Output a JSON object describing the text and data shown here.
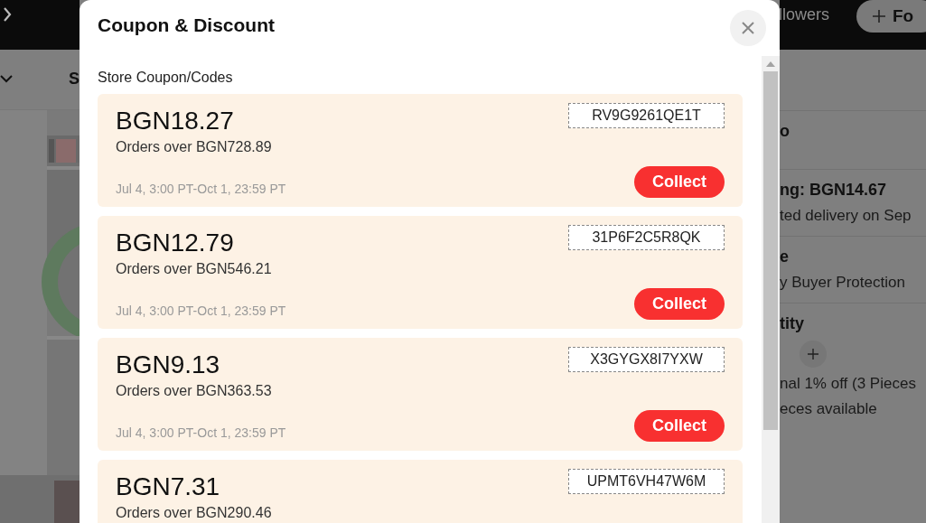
{
  "page": {
    "header": {
      "followers_label": "llowers",
      "follow_button": "Fo"
    },
    "nav": {
      "label": "S"
    },
    "sections": [
      {
        "title": "o"
      },
      {
        "title": "ng: BGN14.67",
        "lines": [
          "ted delivery on Sep"
        ]
      },
      {
        "title": "e",
        "lines": [
          "y Buyer Protection"
        ]
      },
      {
        "title": "tity",
        "kind": "quantity",
        "lines": [
          "nal 1% off (3 Pieces",
          "eces available"
        ]
      }
    ]
  },
  "modal": {
    "title": "Coupon & Discount",
    "section_title": "Store Coupon/Codes",
    "coupons": [
      {
        "amount": "BGN18.27",
        "condition": "Orders over BGN728.89",
        "validity": "Jul 4, 3:00 PT-Oct 1, 23:59 PT",
        "code": "RV9G9261QE1T",
        "button": "Collect"
      },
      {
        "amount": "BGN12.79",
        "condition": "Orders over BGN546.21",
        "validity": "Jul 4, 3:00 PT-Oct 1, 23:59 PT",
        "code": "31P6F2C5R8QK",
        "button": "Collect"
      },
      {
        "amount": "BGN9.13",
        "condition": "Orders over BGN363.53",
        "validity": "Jul 4, 3:00 PT-Oct 1, 23:59 PT",
        "code": "X3GYGX8I7YXW",
        "button": "Collect"
      },
      {
        "amount": "BGN7.31",
        "condition": "Orders over BGN290.46",
        "code": "UPMT6VH47W6M"
      }
    ]
  }
}
